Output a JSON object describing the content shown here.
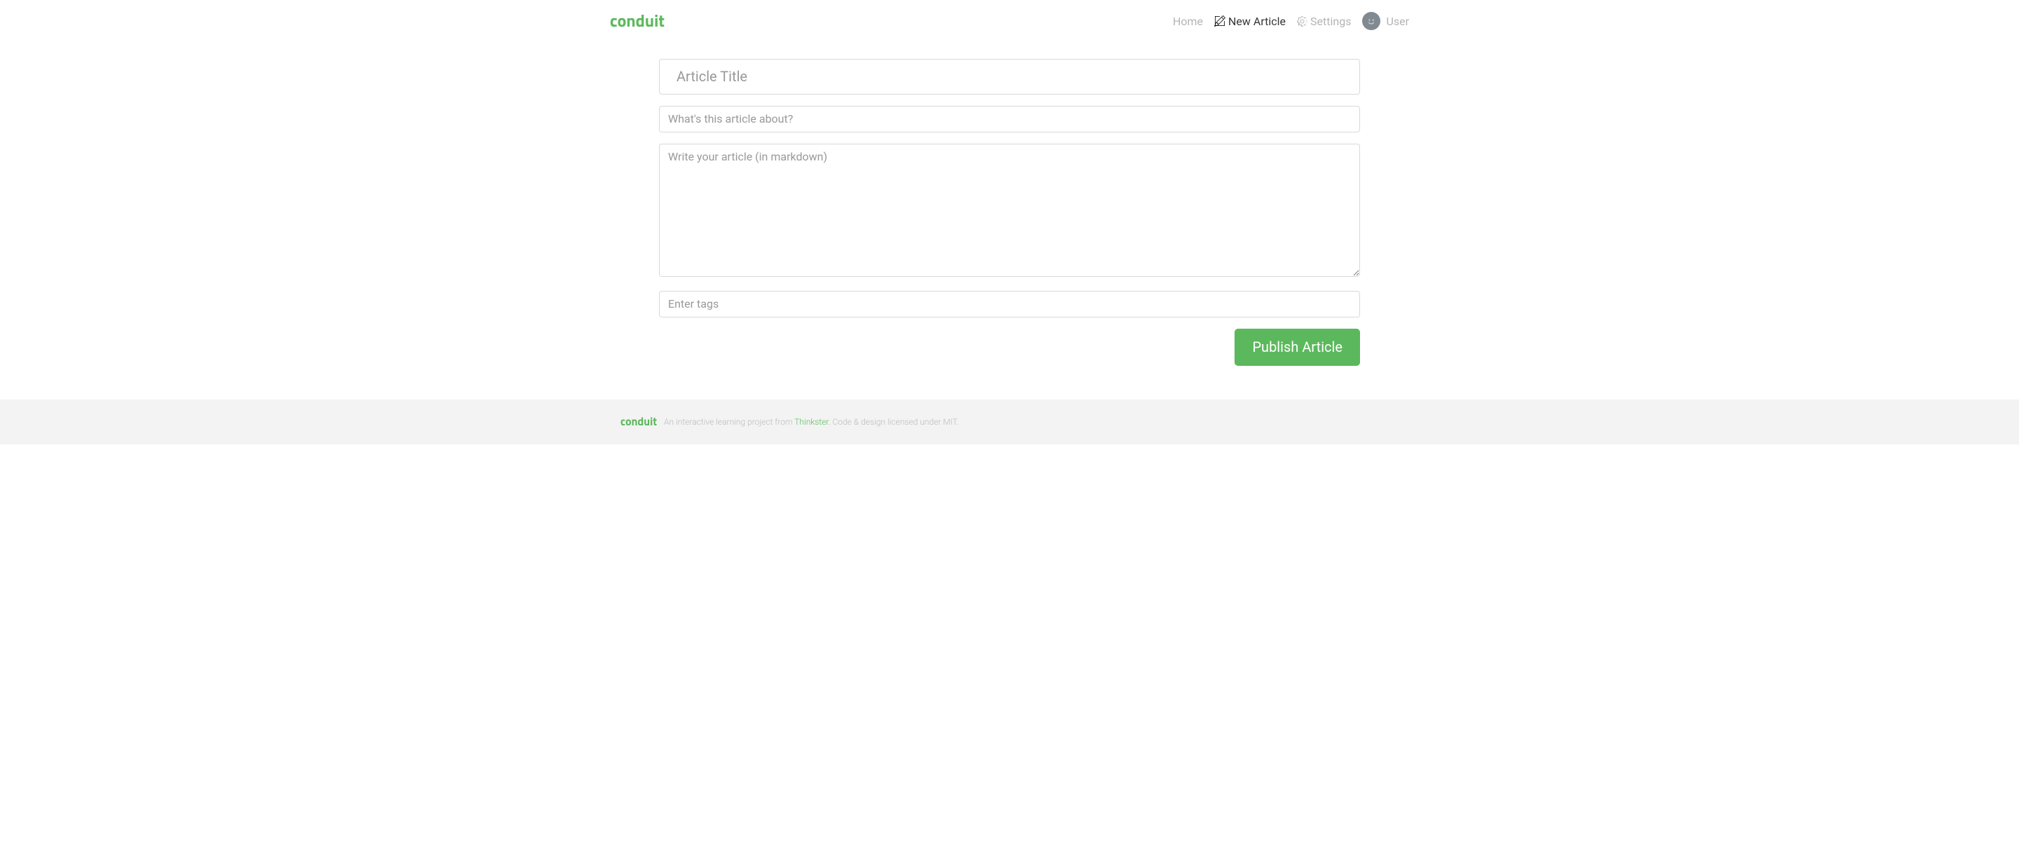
{
  "brand": "conduit",
  "nav": {
    "home": "Home",
    "new_article": "New Article",
    "settings": "Settings",
    "user": "User"
  },
  "editor": {
    "title_placeholder": "Article Title",
    "about_placeholder": "What's this article about?",
    "body_placeholder": "Write your article (in markdown)",
    "tags_placeholder": "Enter tags",
    "publish_button": "Publish Article"
  },
  "footer": {
    "logo": "conduit",
    "text_before": "An interactive learning project from ",
    "link_text": "Thinkster",
    "text_after": ". Code & design licensed under MIT."
  }
}
